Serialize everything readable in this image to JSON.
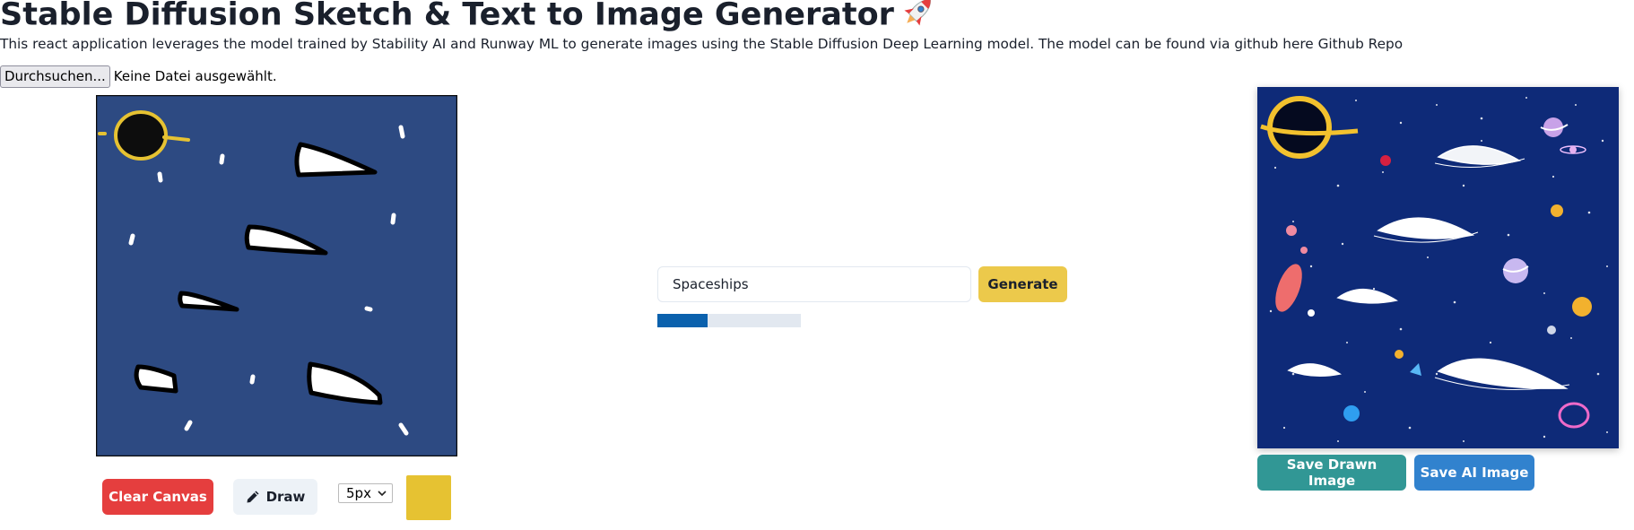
{
  "header": {
    "title": "Stable Diffusion Sketch & Text to Image Generator",
    "description": "This react application leverages the model trained by Stability AI and Runway ML to generate images using the Stable Diffusion Deep Learning model. The model can be found via github here Github Repo"
  },
  "file_input": {
    "button_label": "Durchsuchen...",
    "status_text": "Keine Datei ausgewählt."
  },
  "sketch_tools": {
    "clear_label": "Clear Canvas",
    "draw_label": "Draw",
    "draw_icon": "pencil-icon",
    "brush_size": "5px",
    "selected_color": "#e6c232",
    "canvas_background": "#2d4a82"
  },
  "prompt": {
    "value": "Spaceships",
    "generate_label": "Generate",
    "progress": 0.35
  },
  "output": {
    "save_drawn_label": "Save Drawn Image",
    "save_ai_label": "Save AI Image"
  },
  "colors": {
    "clear": "#e53e3e",
    "generate": "#ecc94b",
    "save_drawn": "#319795",
    "save_ai": "#3182ce",
    "progress": "#0b61ad"
  }
}
